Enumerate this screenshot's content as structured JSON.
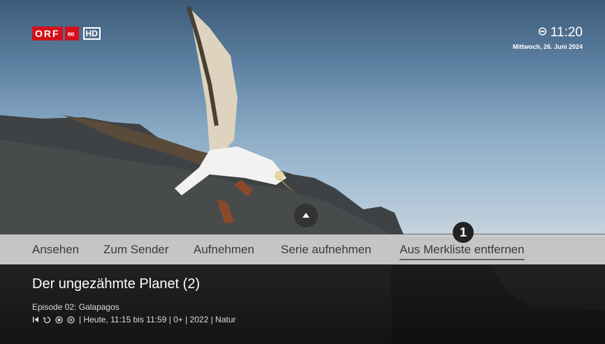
{
  "brand": {
    "channel_letters": "ORF",
    "channel_number": "∞",
    "quality": "HD"
  },
  "clock": {
    "time": "11:20",
    "date": "Mittwoch, 26. Juni 2024"
  },
  "menu": {
    "items": [
      {
        "label": "Ansehen"
      },
      {
        "label": "Zum Sender"
      },
      {
        "label": "Aufnehmen"
      },
      {
        "label": "Serie aufnehmen"
      },
      {
        "label": "Aus Merkliste entfernen"
      }
    ],
    "badge": "1"
  },
  "program": {
    "title": "Der ungezähmte Planet (2)",
    "episode": "Episode 02: Galapagos",
    "details": "| Heute, 11:15 bis 11:59 | 0+ | 2022 | Natur"
  },
  "icons": [
    "restart-icon",
    "replay-icon",
    "record-icon",
    "pause-icon",
    "reminder-icon",
    "up-arrow-icon"
  ]
}
